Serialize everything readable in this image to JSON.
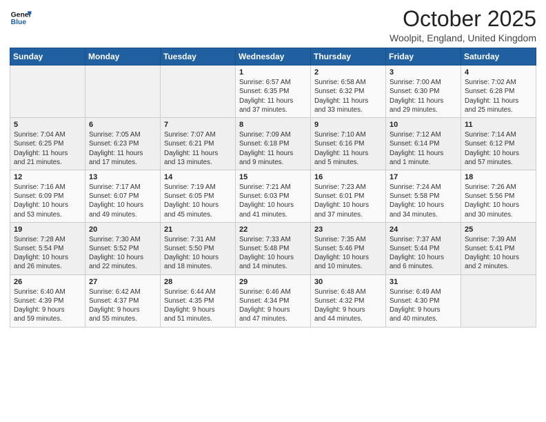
{
  "header": {
    "logo_line1": "General",
    "logo_line2": "Blue",
    "month": "October 2025",
    "location": "Woolpit, England, United Kingdom"
  },
  "days_of_week": [
    "Sunday",
    "Monday",
    "Tuesday",
    "Wednesday",
    "Thursday",
    "Friday",
    "Saturday"
  ],
  "weeks": [
    [
      {
        "day": "",
        "content": ""
      },
      {
        "day": "",
        "content": ""
      },
      {
        "day": "",
        "content": ""
      },
      {
        "day": "1",
        "content": "Sunrise: 6:57 AM\nSunset: 6:35 PM\nDaylight: 11 hours\nand 37 minutes."
      },
      {
        "day": "2",
        "content": "Sunrise: 6:58 AM\nSunset: 6:32 PM\nDaylight: 11 hours\nand 33 minutes."
      },
      {
        "day": "3",
        "content": "Sunrise: 7:00 AM\nSunset: 6:30 PM\nDaylight: 11 hours\nand 29 minutes."
      },
      {
        "day": "4",
        "content": "Sunrise: 7:02 AM\nSunset: 6:28 PM\nDaylight: 11 hours\nand 25 minutes."
      }
    ],
    [
      {
        "day": "5",
        "content": "Sunrise: 7:04 AM\nSunset: 6:25 PM\nDaylight: 11 hours\nand 21 minutes."
      },
      {
        "day": "6",
        "content": "Sunrise: 7:05 AM\nSunset: 6:23 PM\nDaylight: 11 hours\nand 17 minutes."
      },
      {
        "day": "7",
        "content": "Sunrise: 7:07 AM\nSunset: 6:21 PM\nDaylight: 11 hours\nand 13 minutes."
      },
      {
        "day": "8",
        "content": "Sunrise: 7:09 AM\nSunset: 6:18 PM\nDaylight: 11 hours\nand 9 minutes."
      },
      {
        "day": "9",
        "content": "Sunrise: 7:10 AM\nSunset: 6:16 PM\nDaylight: 11 hours\nand 5 minutes."
      },
      {
        "day": "10",
        "content": "Sunrise: 7:12 AM\nSunset: 6:14 PM\nDaylight: 11 hours\nand 1 minute."
      },
      {
        "day": "11",
        "content": "Sunrise: 7:14 AM\nSunset: 6:12 PM\nDaylight: 10 hours\nand 57 minutes."
      }
    ],
    [
      {
        "day": "12",
        "content": "Sunrise: 7:16 AM\nSunset: 6:09 PM\nDaylight: 10 hours\nand 53 minutes."
      },
      {
        "day": "13",
        "content": "Sunrise: 7:17 AM\nSunset: 6:07 PM\nDaylight: 10 hours\nand 49 minutes."
      },
      {
        "day": "14",
        "content": "Sunrise: 7:19 AM\nSunset: 6:05 PM\nDaylight: 10 hours\nand 45 minutes."
      },
      {
        "day": "15",
        "content": "Sunrise: 7:21 AM\nSunset: 6:03 PM\nDaylight: 10 hours\nand 41 minutes."
      },
      {
        "day": "16",
        "content": "Sunrise: 7:23 AM\nSunset: 6:01 PM\nDaylight: 10 hours\nand 37 minutes."
      },
      {
        "day": "17",
        "content": "Sunrise: 7:24 AM\nSunset: 5:58 PM\nDaylight: 10 hours\nand 34 minutes."
      },
      {
        "day": "18",
        "content": "Sunrise: 7:26 AM\nSunset: 5:56 PM\nDaylight: 10 hours\nand 30 minutes."
      }
    ],
    [
      {
        "day": "19",
        "content": "Sunrise: 7:28 AM\nSunset: 5:54 PM\nDaylight: 10 hours\nand 26 minutes."
      },
      {
        "day": "20",
        "content": "Sunrise: 7:30 AM\nSunset: 5:52 PM\nDaylight: 10 hours\nand 22 minutes."
      },
      {
        "day": "21",
        "content": "Sunrise: 7:31 AM\nSunset: 5:50 PM\nDaylight: 10 hours\nand 18 minutes."
      },
      {
        "day": "22",
        "content": "Sunrise: 7:33 AM\nSunset: 5:48 PM\nDaylight: 10 hours\nand 14 minutes."
      },
      {
        "day": "23",
        "content": "Sunrise: 7:35 AM\nSunset: 5:46 PM\nDaylight: 10 hours\nand 10 minutes."
      },
      {
        "day": "24",
        "content": "Sunrise: 7:37 AM\nSunset: 5:44 PM\nDaylight: 10 hours\nand 6 minutes."
      },
      {
        "day": "25",
        "content": "Sunrise: 7:39 AM\nSunset: 5:41 PM\nDaylight: 10 hours\nand 2 minutes."
      }
    ],
    [
      {
        "day": "26",
        "content": "Sunrise: 6:40 AM\nSunset: 4:39 PM\nDaylight: 9 hours\nand 59 minutes."
      },
      {
        "day": "27",
        "content": "Sunrise: 6:42 AM\nSunset: 4:37 PM\nDaylight: 9 hours\nand 55 minutes."
      },
      {
        "day": "28",
        "content": "Sunrise: 6:44 AM\nSunset: 4:35 PM\nDaylight: 9 hours\nand 51 minutes."
      },
      {
        "day": "29",
        "content": "Sunrise: 6:46 AM\nSunset: 4:34 PM\nDaylight: 9 hours\nand 47 minutes."
      },
      {
        "day": "30",
        "content": "Sunrise: 6:48 AM\nSunset: 4:32 PM\nDaylight: 9 hours\nand 44 minutes."
      },
      {
        "day": "31",
        "content": "Sunrise: 6:49 AM\nSunset: 4:30 PM\nDaylight: 9 hours\nand 40 minutes."
      },
      {
        "day": "",
        "content": ""
      }
    ]
  ]
}
